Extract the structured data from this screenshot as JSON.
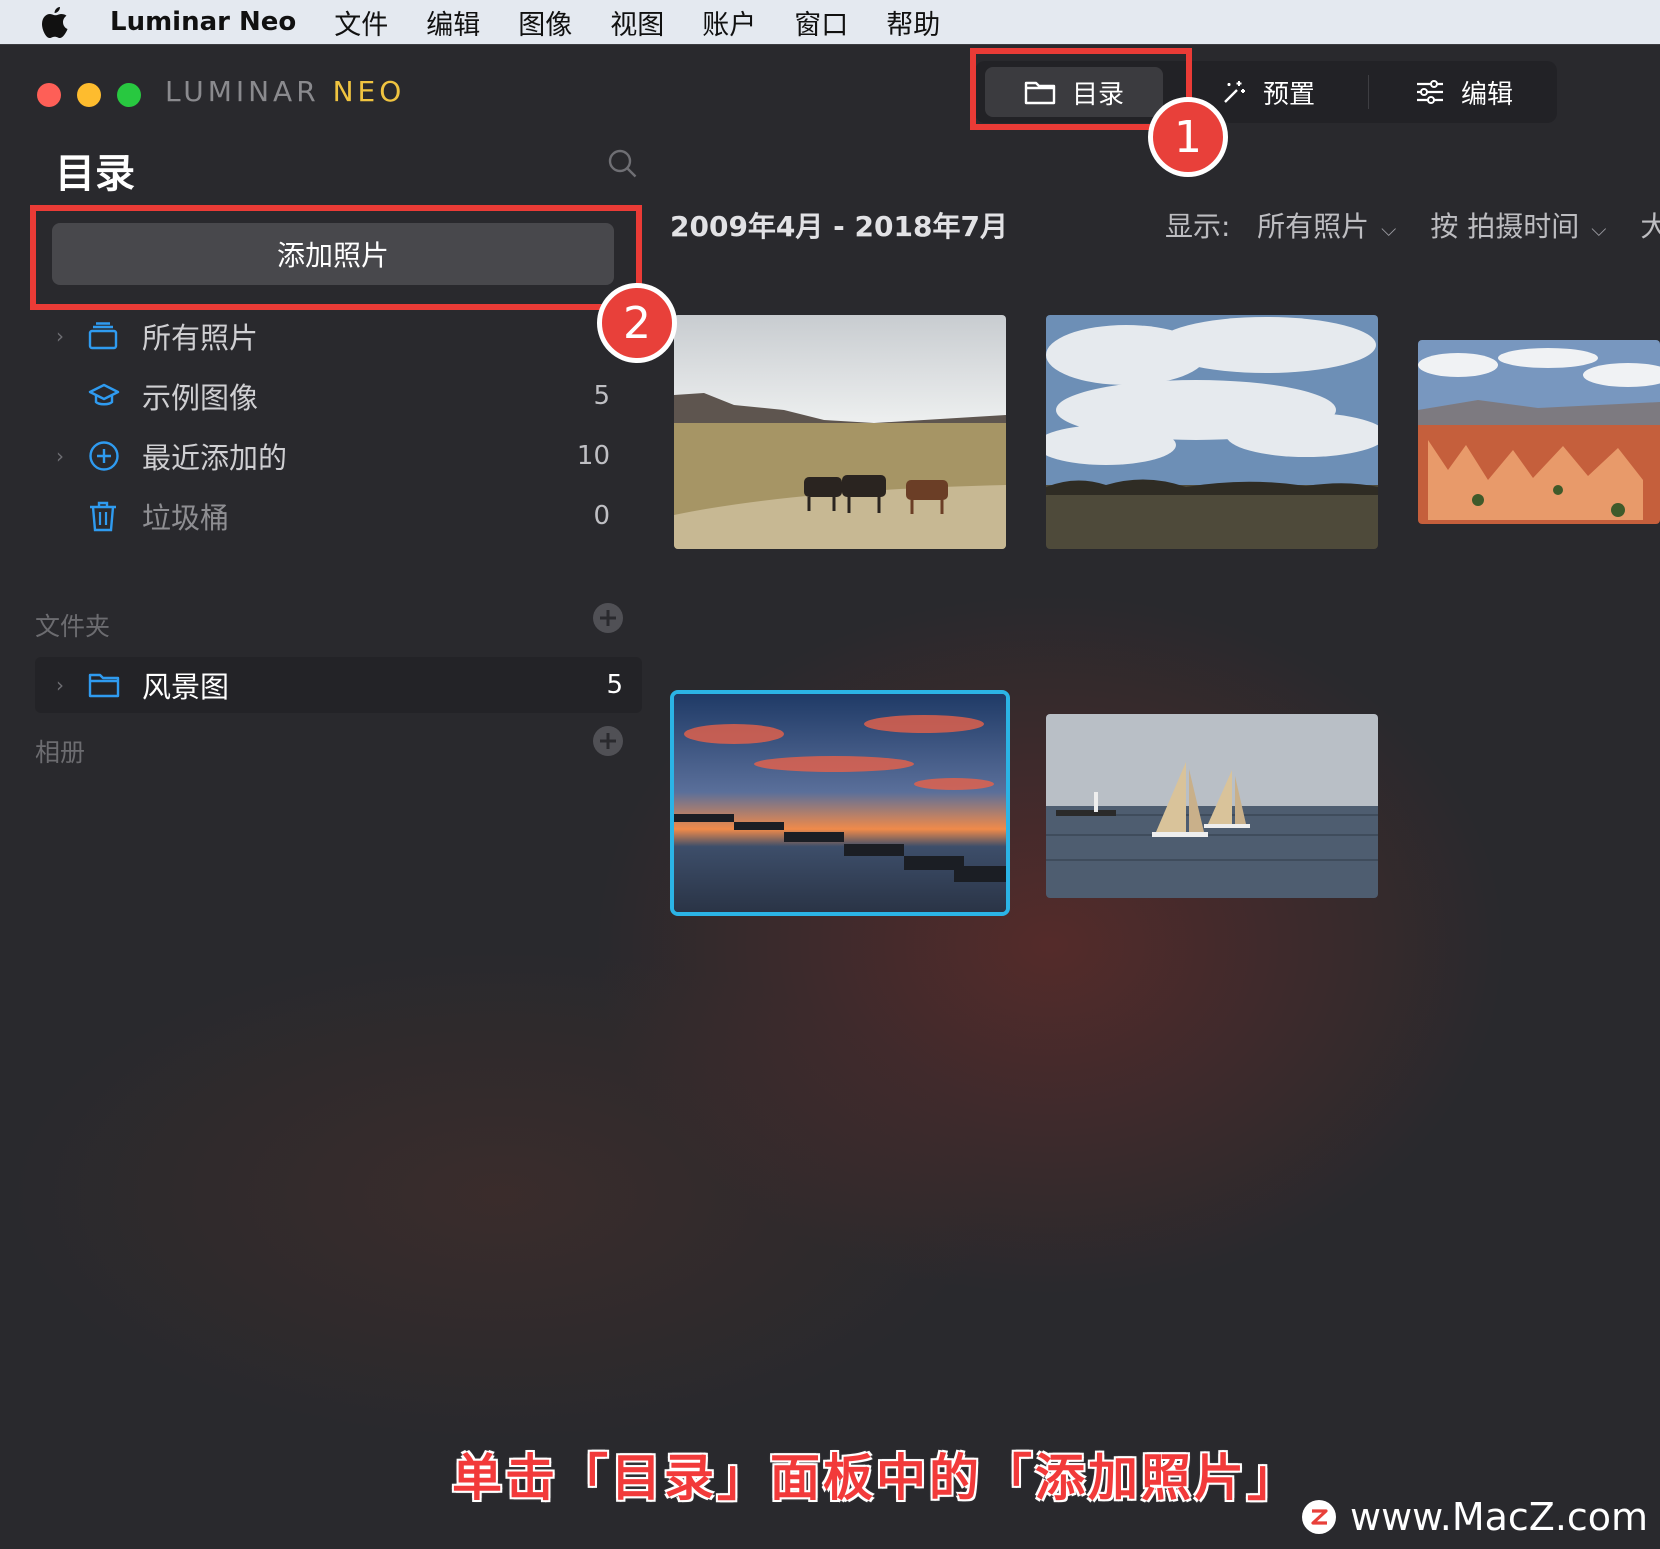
{
  "menubar": {
    "app_name": "Luminar Neo",
    "items": [
      "文件",
      "编辑",
      "图像",
      "视图",
      "账户",
      "窗口",
      "帮助"
    ]
  },
  "window": {
    "logo_a": "LUMINAR",
    "logo_b": "NEO"
  },
  "modes": {
    "catalog": "目录",
    "presets": "预置",
    "edit": "编辑"
  },
  "sidebar": {
    "title": "目录",
    "add_photos": "添加照片",
    "items": [
      {
        "label": "所有照片",
        "count": ""
      },
      {
        "label": "示例图像",
        "count": "5"
      },
      {
        "label": "最近添加的",
        "count": "10"
      },
      {
        "label": "垃圾桶",
        "count": "0"
      }
    ],
    "folders_label": "文件夹",
    "folders": [
      {
        "label": "风景图",
        "count": "5"
      }
    ],
    "albums_label": "相册"
  },
  "main": {
    "date_range": "2009年4月 - 2018年7月",
    "show_label": "显示:",
    "show_value": "所有照片",
    "sort_value": "按 拍摄时间",
    "size_cut": "大"
  },
  "annotations": {
    "badge1": "1",
    "badge2": "2",
    "caption": "单击「目录」面板中的「添加照片」",
    "watermark": "www.MacZ.com"
  },
  "colors": {
    "accent_blue": "#2f9bf0",
    "highlight_red": "#ea3b36",
    "selection_cyan": "#2bb4e6"
  }
}
